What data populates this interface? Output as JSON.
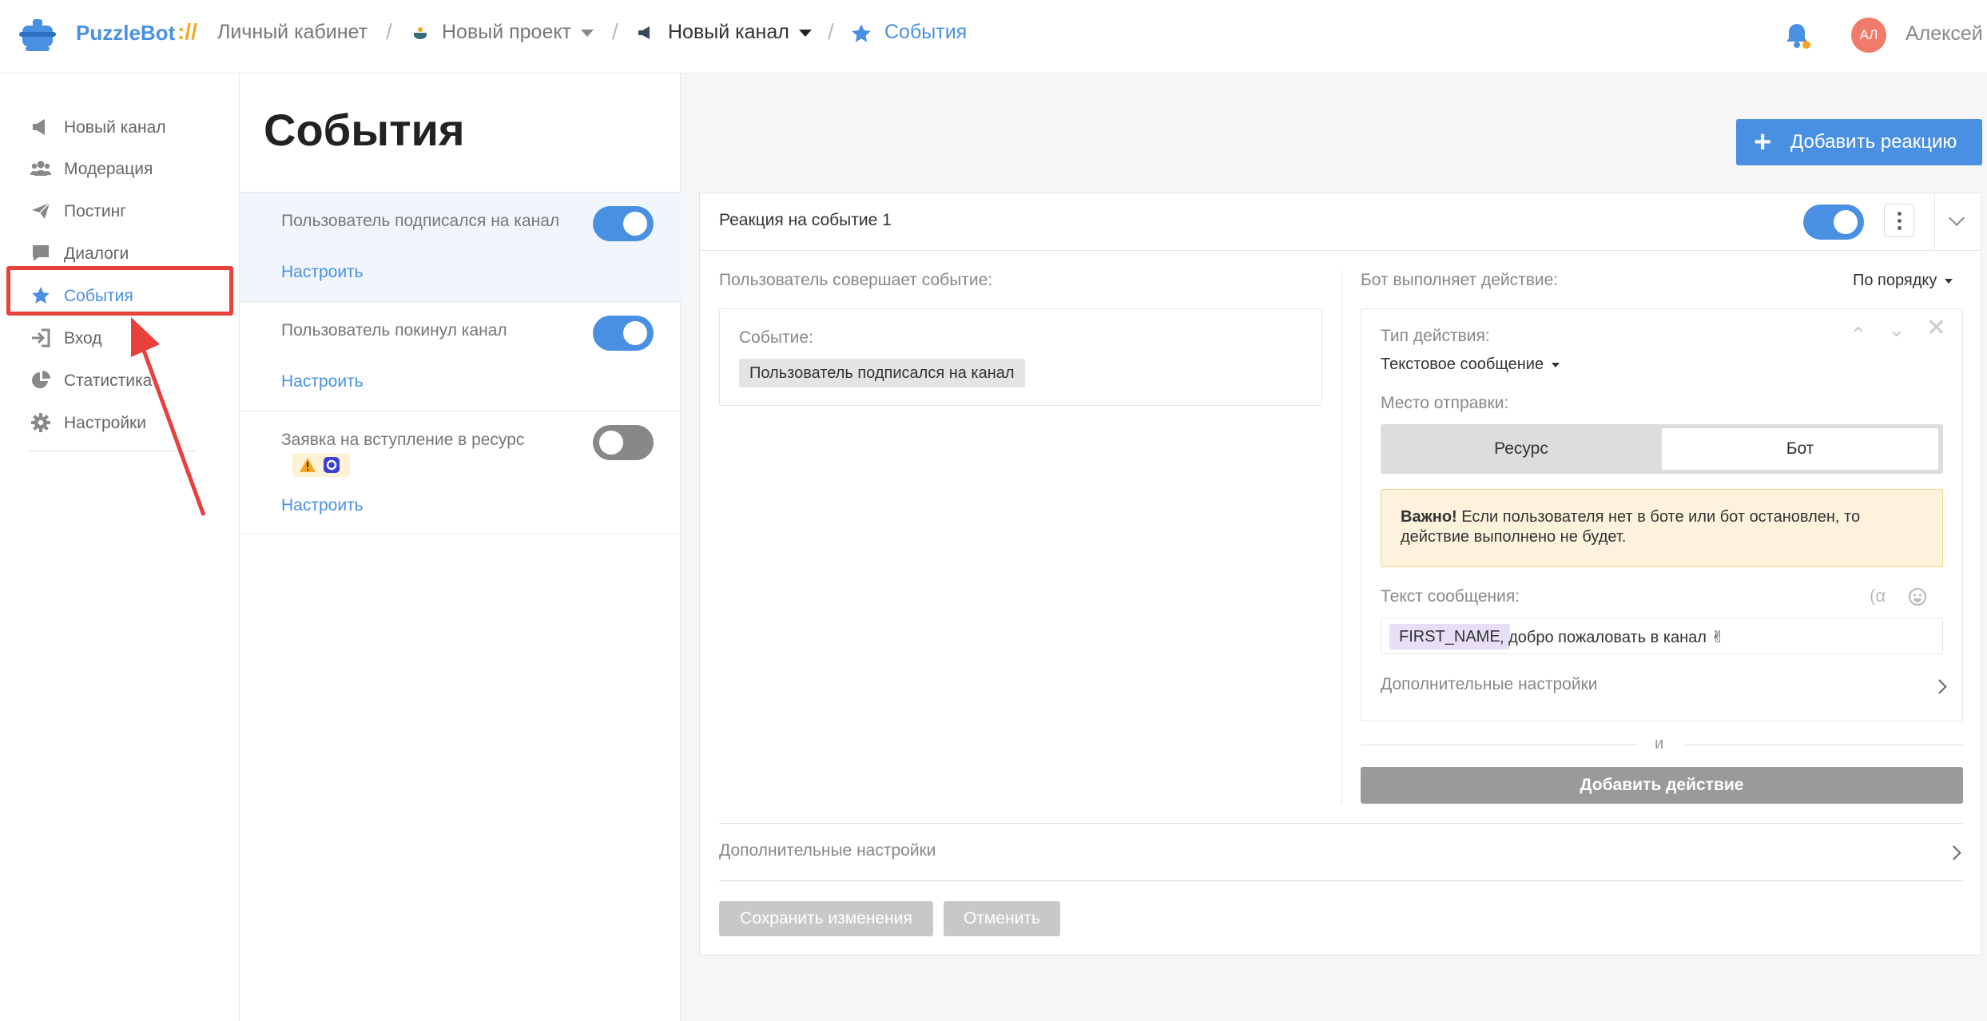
{
  "header": {
    "brand": "PuzzleBot",
    "brand_sep": "://",
    "crumbs": {
      "cabinet": "Личный кабинет",
      "project": "Новый проект",
      "channel": "Новый канал",
      "current": "События"
    },
    "avatar_initials": "АЛ",
    "username": "Алексей"
  },
  "sidebar": {
    "items": [
      {
        "label": "Новый канал",
        "icon": "megaphone-icon"
      },
      {
        "label": "Модерация",
        "icon": "users-icon"
      },
      {
        "label": "Постинг",
        "icon": "paper-plane-icon"
      },
      {
        "label": "Диалоги",
        "icon": "chat-icon"
      },
      {
        "label": "События",
        "icon": "star-icon",
        "active": true
      },
      {
        "label": "Вход",
        "icon": "sign-in-icon"
      },
      {
        "label": "Статистика",
        "icon": "pie-chart-icon"
      },
      {
        "label": "Настройки",
        "icon": "gear-icon"
      }
    ]
  },
  "events_panel": {
    "title": "События",
    "events": [
      {
        "title": "Пользователь подписался на канал",
        "link": "Настроить",
        "enabled": true
      },
      {
        "title": "Пользователь покинул канал",
        "link": "Настроить",
        "enabled": true
      },
      {
        "title": "Заявка на вступление в ресурс",
        "link": "Настроить",
        "enabled": false
      }
    ]
  },
  "main": {
    "add_reaction": "Добавить реакцию",
    "card": {
      "title": "Реакция на событие 1",
      "enabled": true,
      "left_header": "Пользователь совершает событие:",
      "event_label": "Событие:",
      "event_value": "Пользователь подписался на канал",
      "right_header": "Бот выполняет действие:",
      "order": "По порядку",
      "action_type_label": "Тип действия:",
      "action_type_value": "Текстовое сообщение",
      "send_place_label": "Место отправки:",
      "send_options": [
        "Ресурс",
        "Бот"
      ],
      "send_selected": "Бот",
      "warning_bold": "Важно!",
      "warning_text": " Если пользователя нет в боте или бот остановлен, то действие выполнено не будет.",
      "message_label": "Текст сообщения:",
      "message_var": "FIRST_NAME",
      "message_text": ", добро пожаловать в канал ✌",
      "more_settings_inner": "Дополнительные настройки",
      "and": "и",
      "add_action": "Добавить действие",
      "more_settings": "Дополнительные настройки",
      "save": "Сохранить изменения",
      "cancel": "Отменить"
    }
  },
  "colors": {
    "accent": "#4a90e2",
    "brand_sep": "#f5a623",
    "highlight": "#e8403a",
    "warning_bg": "#fdf3dc"
  }
}
